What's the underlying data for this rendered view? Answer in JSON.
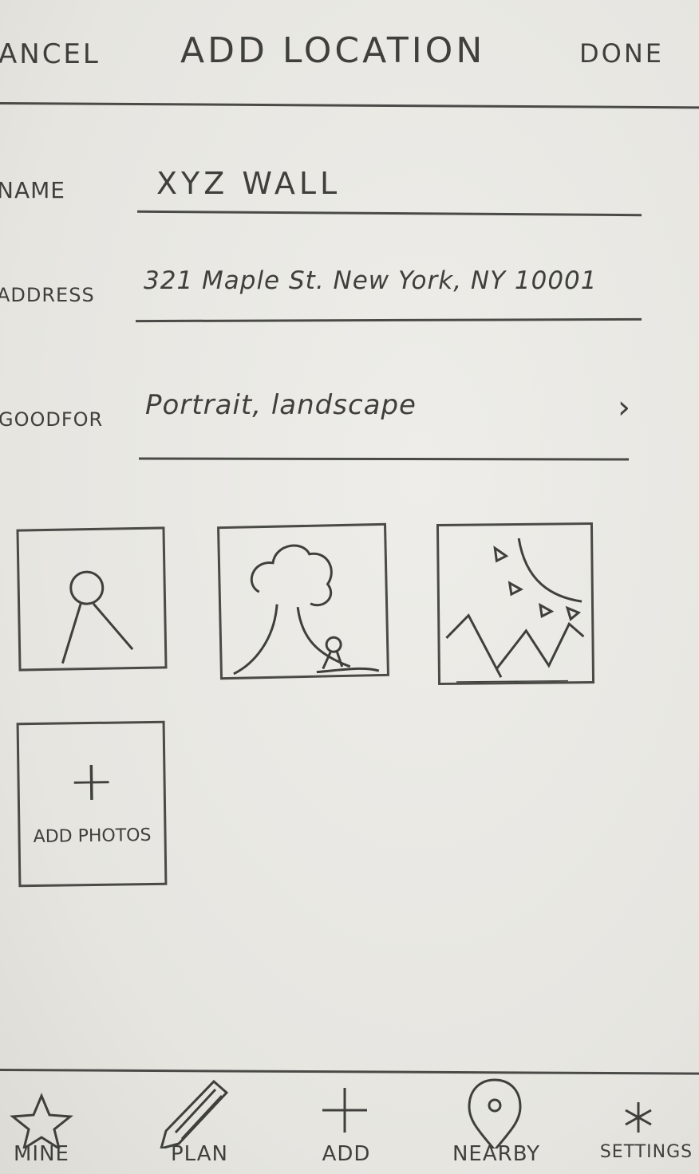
{
  "header": {
    "cancel_label": "ANCEL",
    "title": "ADD LOCATION",
    "done_label": "DONE"
  },
  "form": {
    "name": {
      "label": "NAME",
      "value": "XYZ WALL"
    },
    "address": {
      "label": "ADDRESS",
      "value": "321 Maple St. New York, NY 10001"
    },
    "good_for": {
      "label": "GOODFOR",
      "value": "Portrait, landscape"
    }
  },
  "photos": [
    {
      "icon": "portrait-photo-icon"
    },
    {
      "icon": "tree-person-photo-icon"
    },
    {
      "icon": "landscape-photo-icon"
    }
  ],
  "add_photos": {
    "plus": "+",
    "label": "ADD PHOTOS"
  },
  "tabs": [
    {
      "label": "MINE",
      "icon": "star-icon"
    },
    {
      "label": "PLAN",
      "icon": "pencil-icon"
    },
    {
      "label": "ADD",
      "icon": "plus-icon"
    },
    {
      "label": "NEARBY",
      "icon": "location-pin-icon"
    },
    {
      "label": "SETTINGS",
      "icon": "asterisk-icon"
    }
  ],
  "colors": {
    "paper": "#e9e8e3",
    "ink": "#3f3f3c"
  }
}
